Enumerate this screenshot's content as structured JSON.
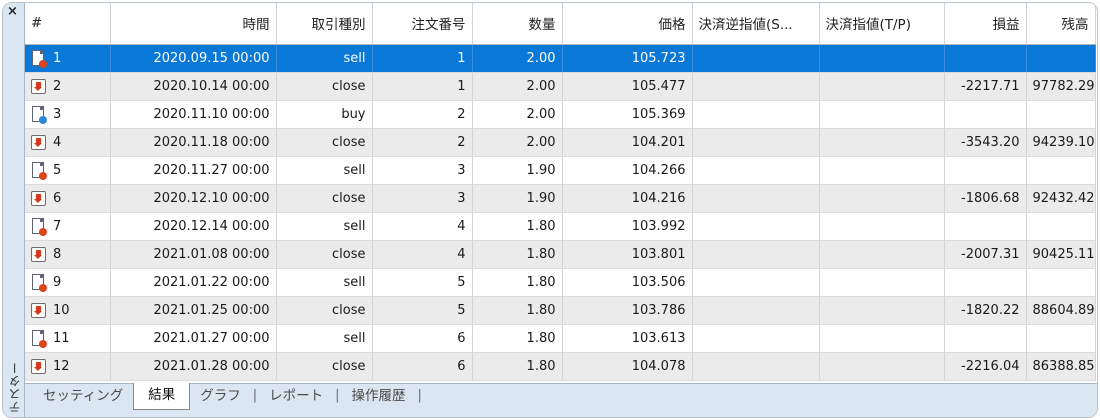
{
  "panel": {
    "close_glyph": "×",
    "title": "テスター"
  },
  "columns": [
    "#",
    "時間",
    "取引種別",
    "注文番号",
    "数量",
    "価格",
    "決済逆指値(S...",
    "決済指値(T/P)",
    "損益",
    "残高"
  ],
  "rows": [
    {
      "icon": "sell-order-icon",
      "id": "1",
      "time": "2020.09.15 00:00",
      "type": "sell",
      "order": "1",
      "qty": "2.00",
      "price": "105.723",
      "sl": "",
      "tp": "",
      "pl": "",
      "balance": ""
    },
    {
      "icon": "close-order-icon",
      "id": "2",
      "time": "2020.10.14 00:00",
      "type": "close",
      "order": "1",
      "qty": "2.00",
      "price": "105.477",
      "sl": "",
      "tp": "",
      "pl": "-2217.71",
      "balance": "97782.29"
    },
    {
      "icon": "buy-order-icon",
      "id": "3",
      "time": "2020.11.10 00:00",
      "type": "buy",
      "order": "2",
      "qty": "2.00",
      "price": "105.369",
      "sl": "",
      "tp": "",
      "pl": "",
      "balance": ""
    },
    {
      "icon": "close-order-icon",
      "id": "4",
      "time": "2020.11.18 00:00",
      "type": "close",
      "order": "2",
      "qty": "2.00",
      "price": "104.201",
      "sl": "",
      "tp": "",
      "pl": "-3543.20",
      "balance": "94239.10"
    },
    {
      "icon": "sell-order-icon",
      "id": "5",
      "time": "2020.11.27 00:00",
      "type": "sell",
      "order": "3",
      "qty": "1.90",
      "price": "104.266",
      "sl": "",
      "tp": "",
      "pl": "",
      "balance": ""
    },
    {
      "icon": "close-order-icon",
      "id": "6",
      "time": "2020.12.10 00:00",
      "type": "close",
      "order": "3",
      "qty": "1.90",
      "price": "104.216",
      "sl": "",
      "tp": "",
      "pl": "-1806.68",
      "balance": "92432.42"
    },
    {
      "icon": "sell-order-icon",
      "id": "7",
      "time": "2020.12.14 00:00",
      "type": "sell",
      "order": "4",
      "qty": "1.80",
      "price": "103.992",
      "sl": "",
      "tp": "",
      "pl": "",
      "balance": ""
    },
    {
      "icon": "close-order-icon",
      "id": "8",
      "time": "2021.01.08 00:00",
      "type": "close",
      "order": "4",
      "qty": "1.80",
      "price": "103.801",
      "sl": "",
      "tp": "",
      "pl": "-2007.31",
      "balance": "90425.11"
    },
    {
      "icon": "sell-order-icon",
      "id": "9",
      "time": "2021.01.22 00:00",
      "type": "sell",
      "order": "5",
      "qty": "1.80",
      "price": "103.506",
      "sl": "",
      "tp": "",
      "pl": "",
      "balance": ""
    },
    {
      "icon": "close-order-icon",
      "id": "10",
      "time": "2021.01.25 00:00",
      "type": "close",
      "order": "5",
      "qty": "1.80",
      "price": "103.786",
      "sl": "",
      "tp": "",
      "pl": "-1820.22",
      "balance": "88604.89"
    },
    {
      "icon": "sell-order-icon",
      "id": "11",
      "time": "2021.01.27 00:00",
      "type": "sell",
      "order": "6",
      "qty": "1.80",
      "price": "103.613",
      "sl": "",
      "tp": "",
      "pl": "",
      "balance": ""
    },
    {
      "icon": "close-order-icon",
      "id": "12",
      "time": "2021.01.28 00:00",
      "type": "close",
      "order": "6",
      "qty": "1.80",
      "price": "104.078",
      "sl": "",
      "tp": "",
      "pl": "-2216.04",
      "balance": "86388.85"
    }
  ],
  "selected_row": 0,
  "tabs": [
    "セッティング",
    "結果",
    "グラフ",
    "レポート",
    "操作履歴"
  ],
  "active_tab": 1,
  "colors": {
    "selection": "#0a78d7",
    "sell_dot": "#e0441b",
    "buy_dot": "#2f87d8",
    "close_arrow": "#d9381e"
  }
}
